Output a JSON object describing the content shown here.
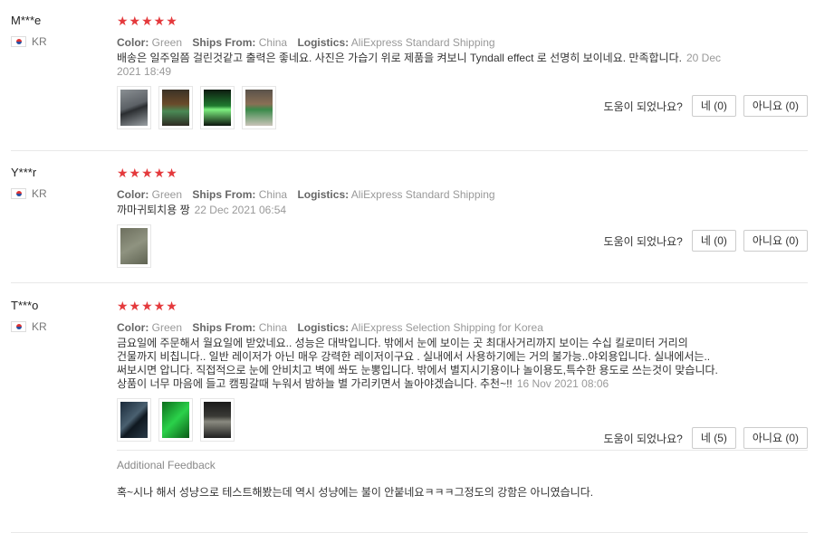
{
  "helpful_question": "도움이 되었나요?",
  "reviews": [
    {
      "user": "M***e",
      "country": "KR",
      "stars": "★★★★★",
      "color_label": "Color:",
      "color": "Green",
      "ships_label": "Ships From:",
      "ships": "China",
      "logistics_label": "Logistics:",
      "logistics": "AliExpress Standard Shipping",
      "text": "배송은 일주일쯤 걸린것같고 출력은 좋네요. 사진은 가습기 위로 제품을 켜보니 Tyndall effect 로 선명히 보이네요. 만족합니다.",
      "date": "20 Dec 2021 18:49",
      "yes": "네 (0)",
      "no": "아니요 (0)"
    },
    {
      "user": "Y***r",
      "country": "KR",
      "stars": "★★★★★",
      "color_label": "Color:",
      "color": "Green",
      "ships_label": "Ships From:",
      "ships": "China",
      "logistics_label": "Logistics:",
      "logistics": "AliExpress Standard Shipping",
      "text": "까마귀퇴치용 짱",
      "date": "22 Dec 2021 06:54",
      "yes": "네 (0)",
      "no": "아니요 (0)"
    },
    {
      "user": "T***o",
      "country": "KR",
      "stars": "★★★★★",
      "color_label": "Color:",
      "color": "Green",
      "ships_label": "Ships From:",
      "ships": "China",
      "logistics_label": "Logistics:",
      "logistics": "AliExpress Selection Shipping for Korea",
      "text": "금요일에 주문해서 월요일에 받았네요.. 성능은 대박입니다. 밖에서 눈에 보이는 곳 최대사거리까지 보이는 수십 킬로미터 거리의 건물까지 비칩니다.. 일반 레이저가 아닌 매우 강력한 레이저이구요 . 실내에서 사용하기에는 거의 불가능..야외용입니다. 실내에서는..써보시면 압니다. 직접적으로 눈에 안비치고 벽에 쏴도 눈뽕입니다. 밖에서 별지시기용이나 놀이용도,특수한 용도로 쓰는것이 맞습니다. 상품이 너무 마음에 들고 캠핑갈때 누워서 밤하늘 별 가리키면서 놀아야겠습니다. 추천~!!",
      "date": "16 Nov 2021 08:06",
      "yes": "네 (5)",
      "no": "아니요 (0)",
      "additional_title": "Additional Feedback",
      "additional_text": "혹~시나 해서 성냥으로 테스트해봤는데 역시 성냥에는 불이 안붙네요ㅋㅋㅋ그정도의 강함은 아니였습니다."
    }
  ]
}
